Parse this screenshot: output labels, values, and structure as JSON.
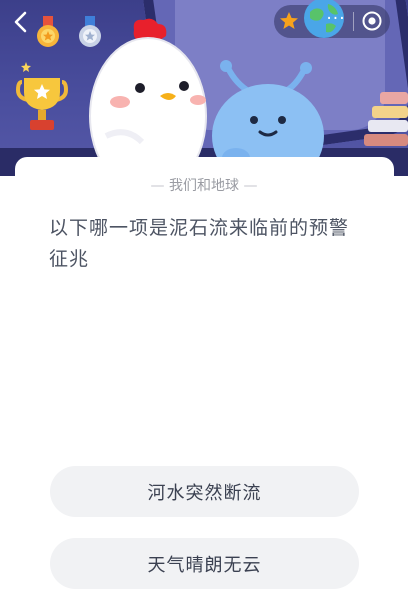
{
  "header": {
    "back_icon": "chevron-left-icon",
    "menu_icon": "more-dots-icon",
    "close_icon": "target-circle-icon",
    "more_label": "···"
  },
  "card": {
    "category": "我们和地球",
    "question": "以下哪一项是泥石流来临前的预警征兆",
    "options": [
      {
        "label": "河水突然断流"
      },
      {
        "label": "天气晴朗无云"
      }
    ]
  },
  "colors": {
    "banner_background": "#4a4e9e",
    "card_background": "#ffffff",
    "option_background": "#f1f2f4",
    "question_text": "#4d5463",
    "category_text": "#9a9ca3"
  }
}
